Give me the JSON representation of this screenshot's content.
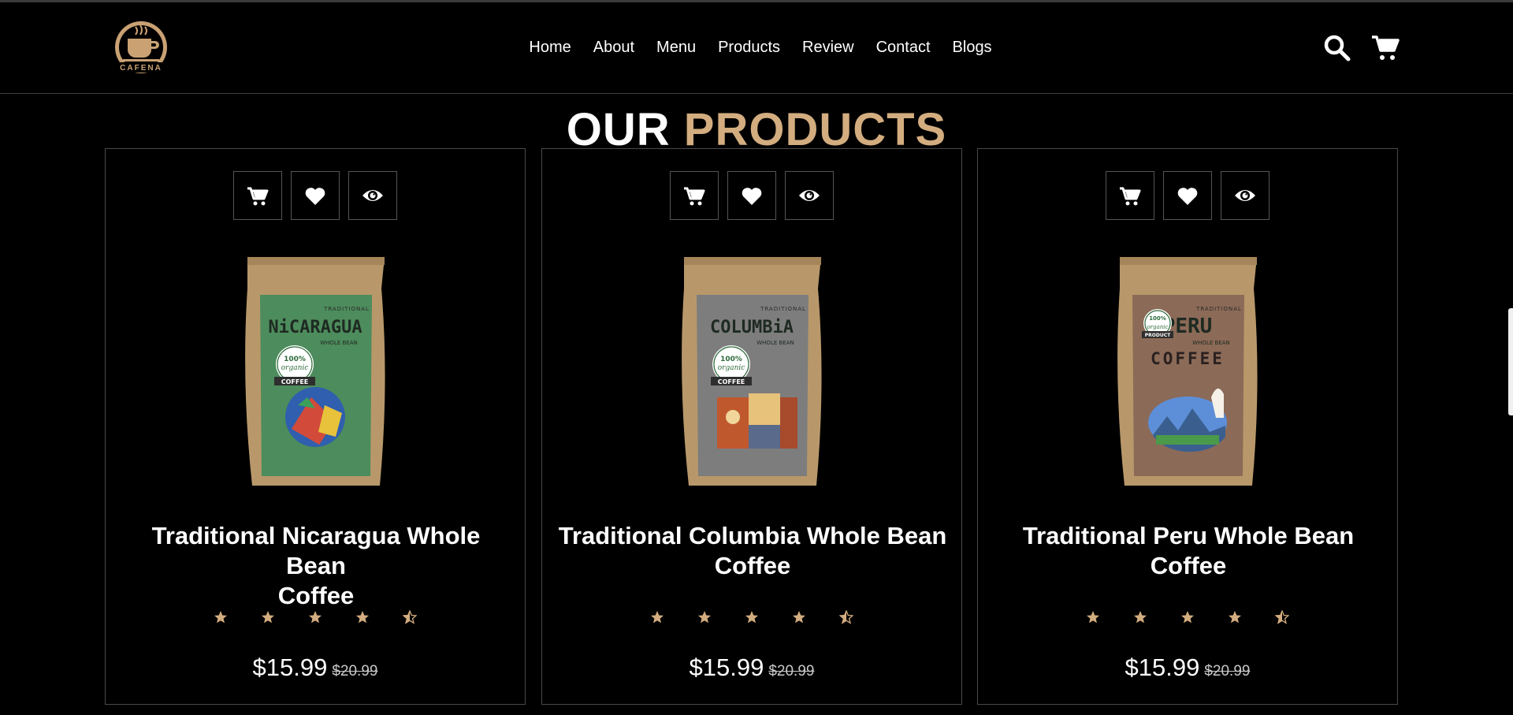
{
  "brand": {
    "name": "CAFENA"
  },
  "nav": {
    "items": [
      {
        "label": "Home"
      },
      {
        "label": "About"
      },
      {
        "label": "Menu"
      },
      {
        "label": "Products"
      },
      {
        "label": "Review"
      },
      {
        "label": "Contact"
      },
      {
        "label": "Blogs"
      }
    ]
  },
  "header_icons": {
    "search": "search-icon",
    "cart": "cart-icon"
  },
  "section": {
    "title_main": "OUR",
    "title_accent": "PRODUCTS"
  },
  "colors": {
    "accent": "#d3ad7f",
    "background": "#000000",
    "text": "#ffffff",
    "border": "#4a4a4a"
  },
  "card_actions": [
    "cart-icon",
    "heart-icon",
    "eye-icon"
  ],
  "products": [
    {
      "title_line1": "Traditional Nicaragua Whole Bean",
      "title_line2": "Coffee",
      "price": "$15.99",
      "old_price": "$20.99",
      "rating": 4.5,
      "bag": {
        "label_top": "TRADITIONAL",
        "name": "NiCARAGUA",
        "sub": "WHOLE BEAN",
        "badge_1": "100%",
        "badge_2": "organic",
        "ribbon": "COFFEE",
        "label_color": "#4d8c5c"
      }
    },
    {
      "title_line1": "Traditional Columbia Whole Bean",
      "title_line2": "Coffee",
      "price": "$15.99",
      "old_price": "$20.99",
      "rating": 4.5,
      "bag": {
        "label_top": "TRADITIONAL",
        "name": "COLUMBiA",
        "sub": "WHOLE BEAN",
        "badge_1": "100%",
        "badge_2": "organic",
        "ribbon": "COFFEE",
        "label_color": "#7d7d7d"
      }
    },
    {
      "title_line1": "Traditional Peru Whole Bean",
      "title_line2": "Coffee",
      "price": "$15.99",
      "old_price": "$20.99",
      "rating": 4.5,
      "bag": {
        "label_top": "TRADITIONAL",
        "name": "PERU",
        "sub": "WHOLE BEAN",
        "badge_1": "100%",
        "badge_2": "organic",
        "ribbon": "PRODUCT",
        "extra": "COFFEE",
        "label_color": "#8b6a57"
      }
    }
  ]
}
